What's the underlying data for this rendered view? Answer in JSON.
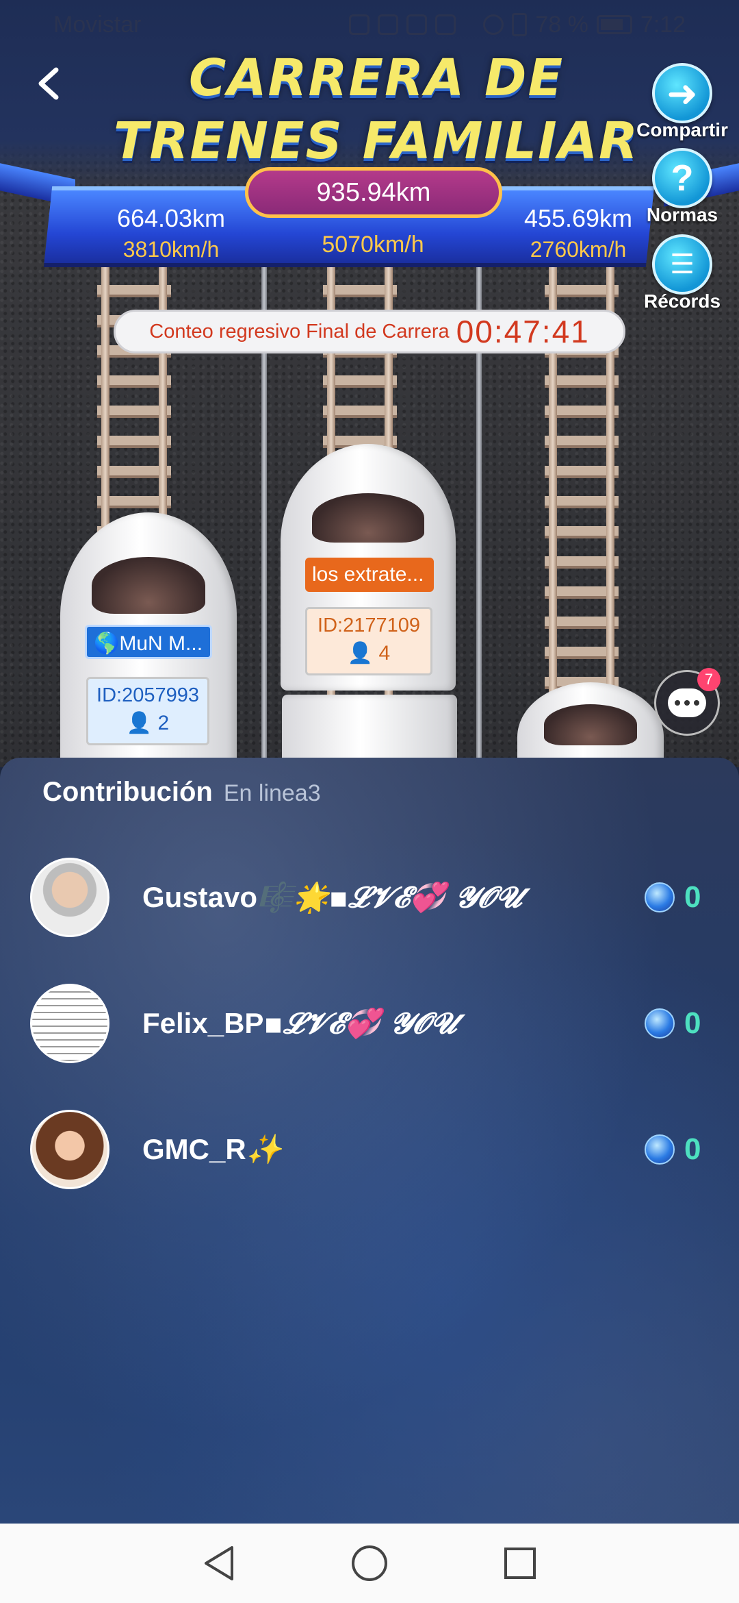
{
  "status_bar": {
    "carrier": "Movistar",
    "battery": "78 %",
    "time": "7:12"
  },
  "header": {
    "title": "CARRERA DE TRENES FAMILIAR",
    "share_label": "Compartir",
    "rules_label": "Normas",
    "records_label": "Récords"
  },
  "race": {
    "total_distance": "935.94km",
    "total_speed": "5070km/h",
    "left_distance": "664.03km",
    "left_speed": "3810km/h",
    "right_distance": "455.69km",
    "right_speed": "2760km/h",
    "countdown_label": "Conteo regresivo Final de Carrera",
    "countdown_time": "00:47:41"
  },
  "trains": [
    {
      "team": "🌎MuN M...",
      "id": "ID:2057993",
      "members": "2",
      "tag_color": "#1e6fd8"
    },
    {
      "team": "los extrate...",
      "id": "ID:2177109",
      "members": "4",
      "tag_color": "#e8681c"
    }
  ],
  "chat": {
    "badge": "7"
  },
  "contribution": {
    "title": "Contribución",
    "online": "En linea3",
    "users": [
      {
        "name": "Gustavo",
        "decor": "🎼🌟▪𝓛𝓥𝓔💞 𝓨𝓞𝓤",
        "score": "0"
      },
      {
        "name": "Felix_BP",
        "decor": "▪𝓛𝓥𝓔💞 𝓨𝓞𝓤",
        "score": "0"
      },
      {
        "name": "GMC_R",
        "decor": "✨",
        "score": "0"
      }
    ]
  },
  "colors": {
    "title_yellow": "#f6e96a",
    "countdown_red": "#d2391f",
    "score_teal": "#4de0c0",
    "speed_yellow": "#ffc94a"
  }
}
